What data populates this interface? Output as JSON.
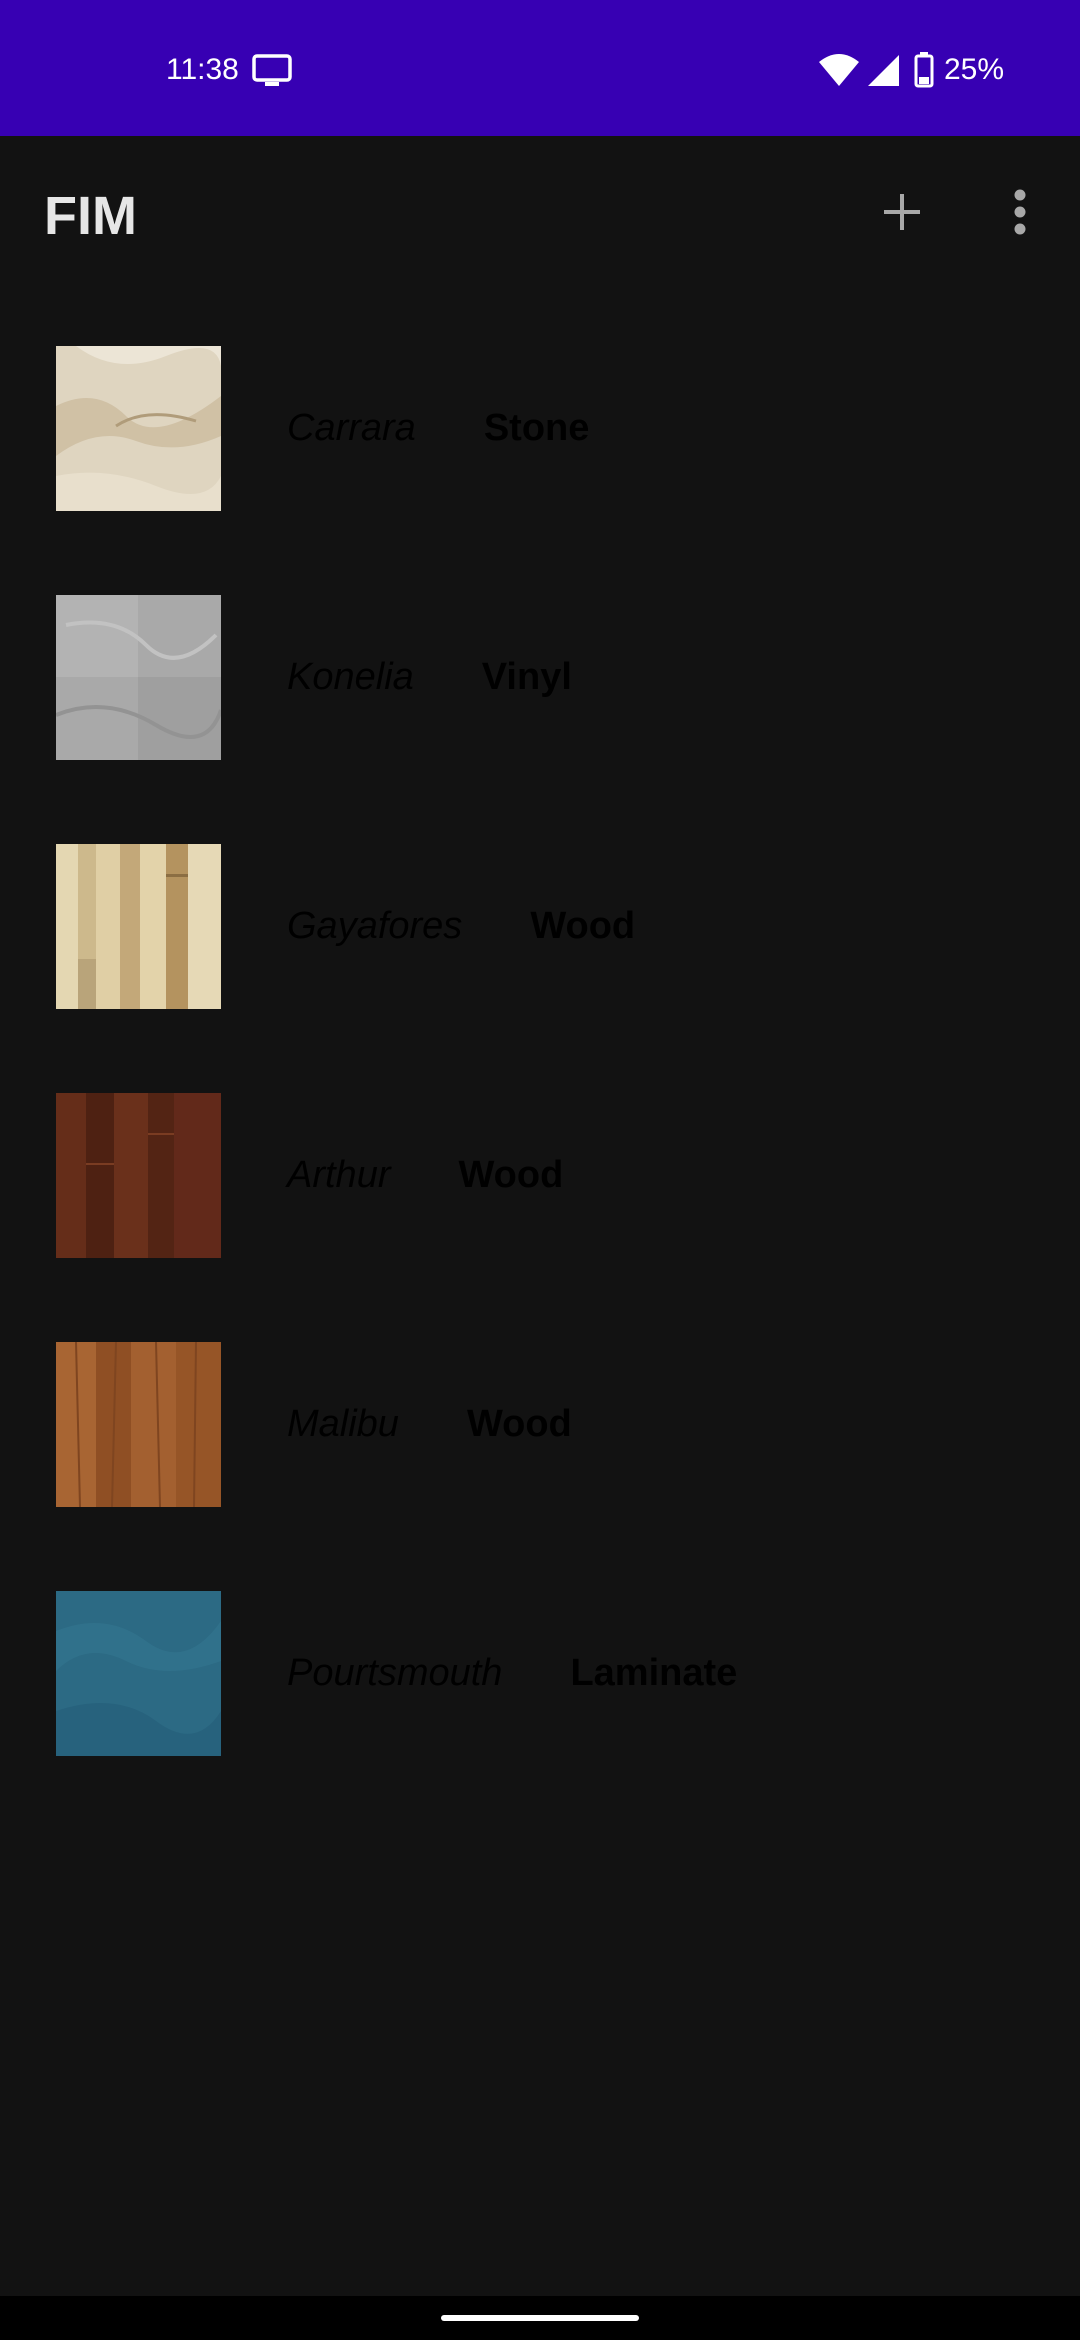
{
  "status_bar": {
    "time": "11:38",
    "battery": "25%",
    "icons": [
      "cast-icon",
      "wifi-icon",
      "signal-icon",
      "battery-icon"
    ],
    "background": "#3700b3"
  },
  "app_bar": {
    "title": "FIM",
    "actions": [
      "add-icon",
      "more-vert-icon"
    ]
  },
  "floors": [
    {
      "name": "Carrara",
      "type": "Stone",
      "swatch": "#dcd2bd"
    },
    {
      "name": "Konelia",
      "type": "Vinyl",
      "swatch": "#a7a7a7"
    },
    {
      "name": "Gayafores",
      "type": "Wood",
      "swatch": "#d6c49a"
    },
    {
      "name": "Arthur",
      "type": "Wood",
      "swatch": "#5a2716"
    },
    {
      "name": "Malibu",
      "type": "Wood",
      "swatch": "#9c5a2b"
    },
    {
      "name": "Pourtsmouth",
      "type": "Laminate",
      "swatch": "#2c6a84"
    }
  ],
  "colors": {
    "background": "#121212",
    "title_text": "#e6e6e6",
    "item_text": "#000000"
  }
}
